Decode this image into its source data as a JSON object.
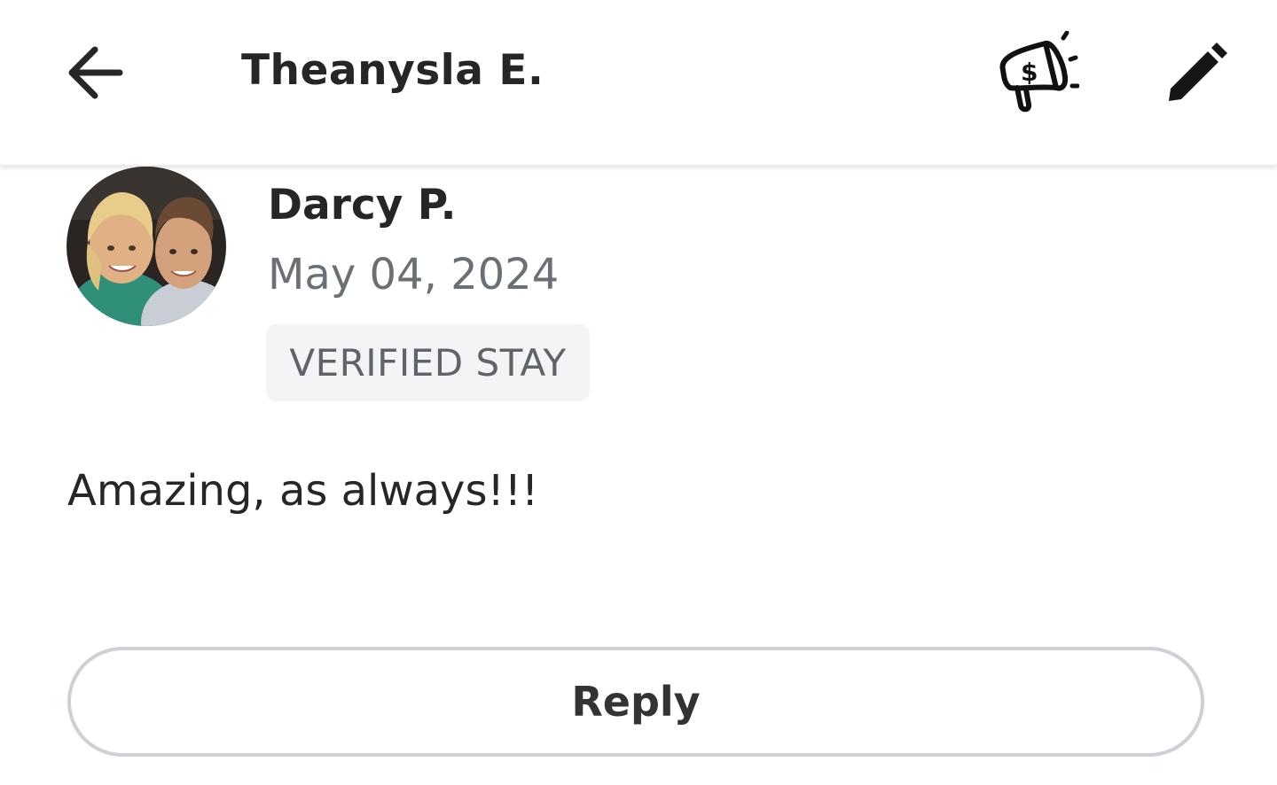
{
  "header": {
    "title": "Theanysla E.",
    "back_icon": "arrow-left-icon",
    "promo_icon": "megaphone-dollar-icon",
    "edit_icon": "pencil-icon"
  },
  "review": {
    "reviewer_name": "Darcy P.",
    "date": "May 04, 2024",
    "badge": "VERIFIED STAY",
    "text": "Amazing, as always!!!"
  },
  "actions": {
    "reply_label": "Reply"
  },
  "colors": {
    "text_primary": "#262626",
    "text_secondary": "#6b6f76",
    "badge_bg": "#f3f4f6",
    "button_border": "#cdd0d5"
  }
}
